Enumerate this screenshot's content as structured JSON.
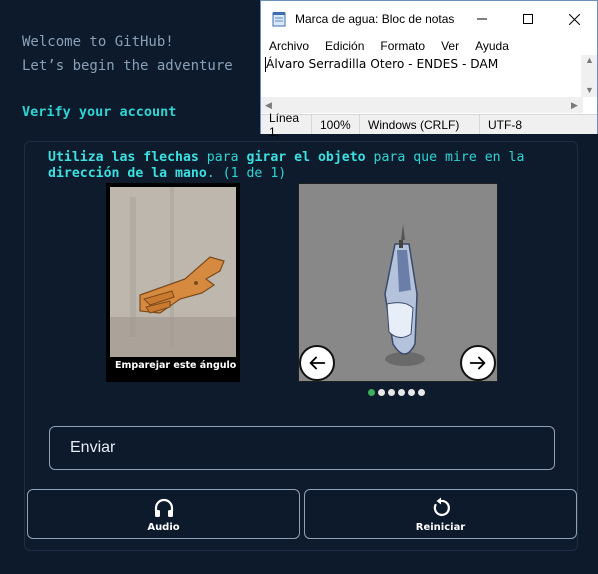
{
  "github": {
    "welcome_line1": "Welcome to GitHub!",
    "welcome_line2": "Let’s begin the adventure",
    "verify": "Verify your account"
  },
  "captcha": {
    "instruction_parts": [
      {
        "text": "Utiliza las flechas ",
        "bold": true
      },
      {
        "text": "para ",
        "bold": false
      },
      {
        "text": "girar el objeto ",
        "bold": true
      },
      {
        "text": "para que mire en la ",
        "bold": false
      },
      {
        "text": "dirección de la mano",
        "bold": true
      },
      {
        "text": ". (1 de 1)",
        "bold": false
      }
    ],
    "reference_label": "Emparejar este ángulo",
    "page_dots": 6,
    "active_dot": 0,
    "left_arrow": "left-arrow-icon",
    "right_arrow": "right-arrow-icon",
    "submit_label": "Enviar",
    "audio_label": "Audio",
    "reset_label": "Reiniciar"
  },
  "notepad": {
    "title": "Marca de agua: Bloc de notas",
    "menu": [
      "Archivo",
      "Edición",
      "Formato",
      "Ver",
      "Ayuda"
    ],
    "content": "Álvaro Serradilla Otero - ENDES - DAM",
    "status": {
      "position": "Línea 1,",
      "zoom": "100%",
      "line_endings": "Windows (CRLF)",
      "encoding": "UTF-8"
    }
  },
  "colors": {
    "background": "#0d1a2b",
    "accent": "#2fd4d4",
    "dot_active": "#3fae5a"
  }
}
